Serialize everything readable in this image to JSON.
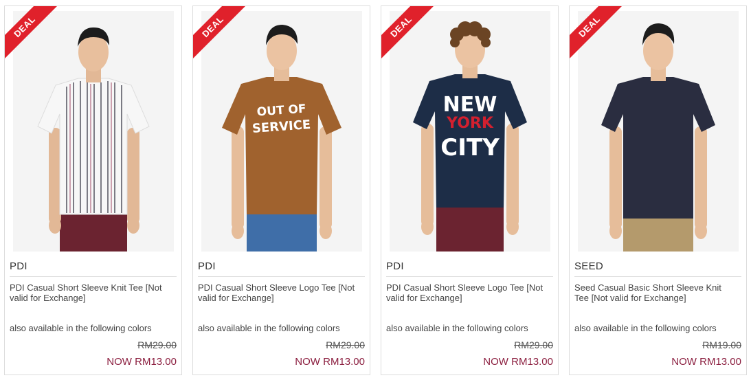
{
  "products": [
    {
      "badge": "DEAL",
      "brand": "PDI",
      "title": "PDI Casual Short Sleeve Knit Tee [Not valid for Exchange]",
      "colors_label": "also available in the following colors",
      "old_price": "RM29.00",
      "now_price": "NOW RM13.00",
      "image": {
        "shirt_color": "#f7f7f7",
        "pattern": "vertical-stripes",
        "pants_color": "#6b2330",
        "hair": "short-dark"
      }
    },
    {
      "badge": "DEAL",
      "brand": "PDI",
      "title": "PDI Casual Short Sleeve Logo Tee [Not valid for Exchange]",
      "colors_label": "also available in the following colors",
      "old_price": "RM29.00",
      "now_price": "NOW RM13.00",
      "image": {
        "shirt_color": "#a0622e",
        "print_text": [
          "OUT OF",
          "SERVICE"
        ],
        "pants_color": "#3f6ea8",
        "hair": "short-dark"
      }
    },
    {
      "badge": "DEAL",
      "brand": "PDI",
      "title": "PDI Casual Short Sleeve Logo Tee [Not valid for Exchange]",
      "colors_label": "also available in the following colors",
      "old_price": "RM29.00",
      "now_price": "NOW RM13.00",
      "image": {
        "shirt_color": "#1d2d47",
        "print_text": [
          "NEW",
          "YORK",
          "CITY"
        ],
        "print_accent": "#d3202f",
        "pants_color": "#6b2330",
        "hair": "curly"
      }
    },
    {
      "badge": "DEAL",
      "brand": "SEED",
      "title": "Seed Casual Basic Short Sleeve Knit Tee [Not valid for Exchange]",
      "colors_label": "also available in the following colors",
      "old_price": "RM19.00",
      "now_price": "NOW RM13.00",
      "image": {
        "shirt_color": "#2a2d40",
        "pants_color": "#b49a6c",
        "hair": "short-dark"
      }
    }
  ]
}
